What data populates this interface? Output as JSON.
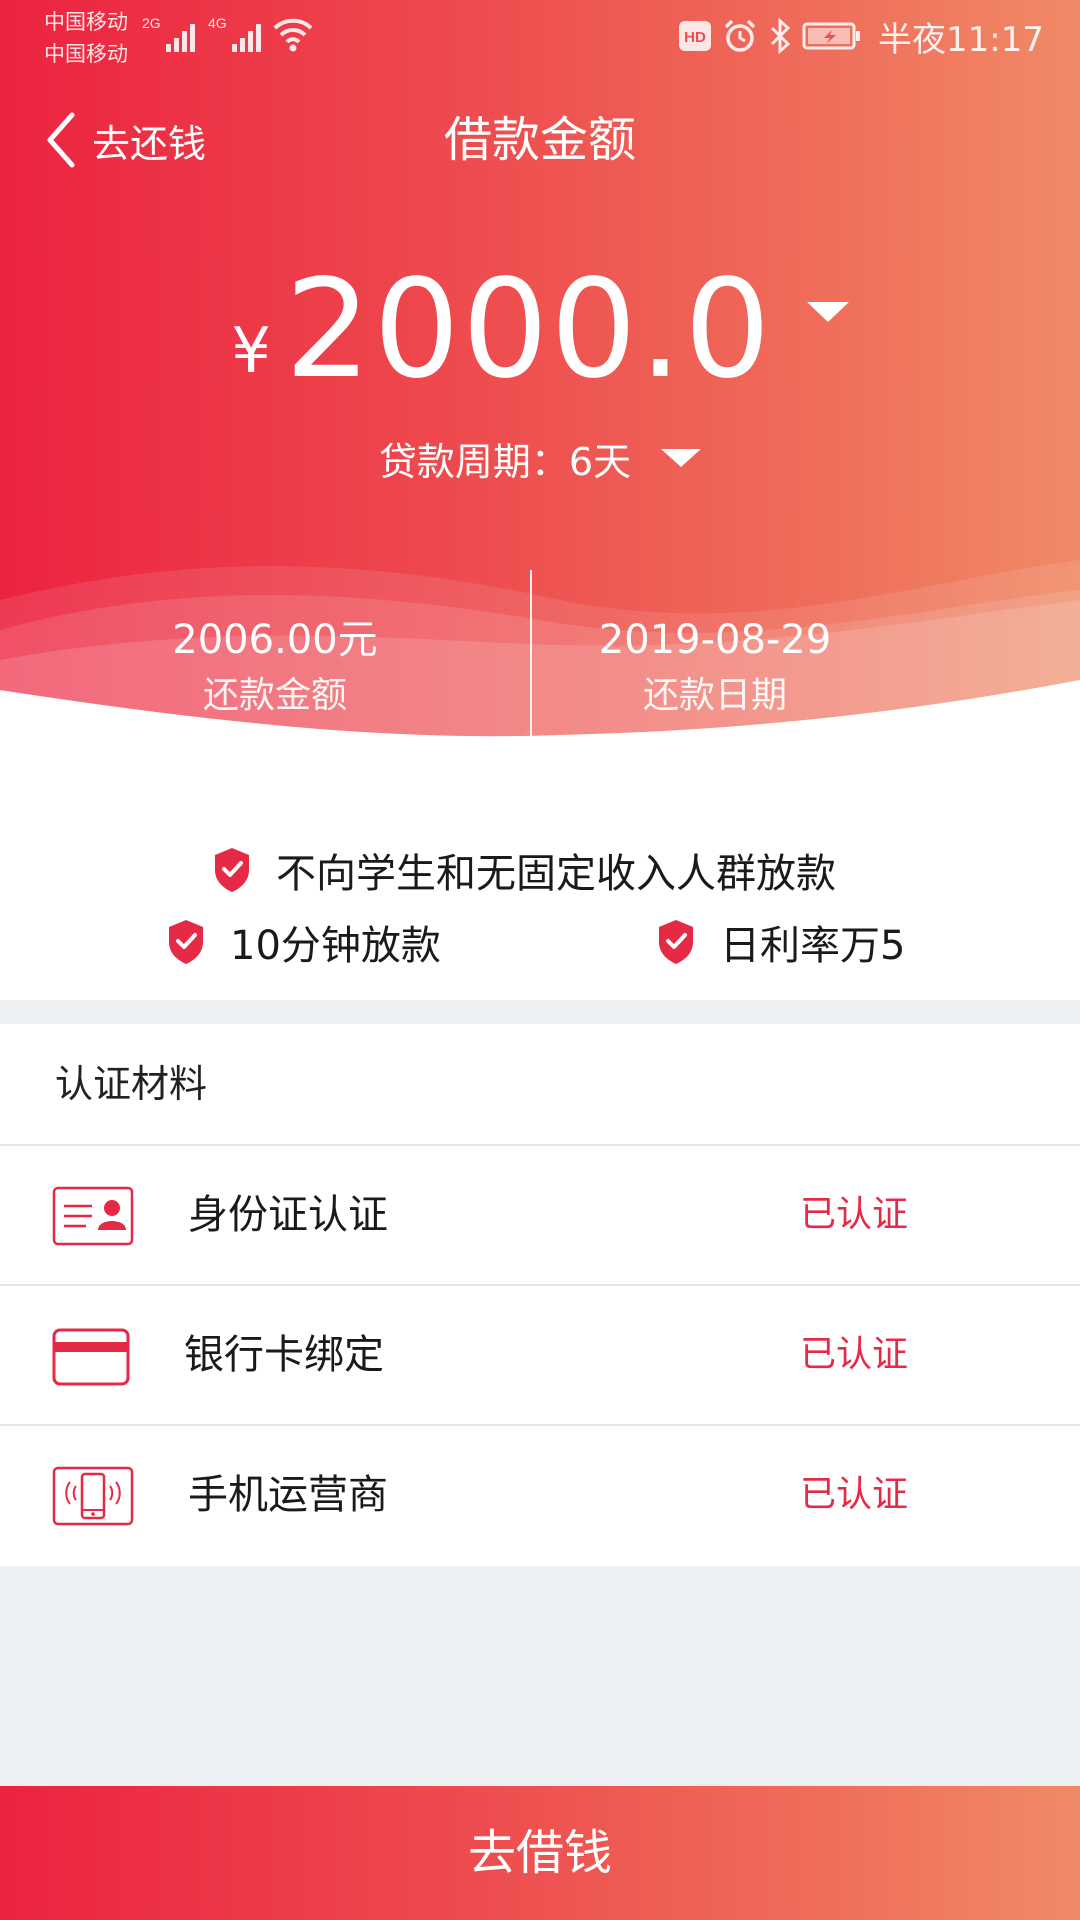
{
  "status_bar": {
    "carrier_1": "中国移动",
    "carrier_2": "中国移动",
    "network_1": "2G",
    "network_2": "4G",
    "hd": "HD",
    "time": "半夜11:17",
    "icons": [
      "signal-icon",
      "wifi-icon",
      "hd-icon",
      "alarm-icon",
      "bluetooth-icon",
      "battery-icon"
    ]
  },
  "nav": {
    "back_label": "去还钱",
    "title": "借款金额"
  },
  "loan": {
    "currency": "¥",
    "amount": "2000.0",
    "period_text": "贷款周期：6天"
  },
  "summary": {
    "repay_amount": "2006.00元",
    "repay_amount_label": "还款金额",
    "repay_date": "2019-08-29",
    "repay_date_label": "还款日期"
  },
  "promises": [
    {
      "text": "不向学生和无固定收入人群放款",
      "icon": "shield-check-icon"
    },
    {
      "text": "10分钟放款",
      "icon": "shield-check-icon"
    },
    {
      "text": "日利率万5",
      "icon": "shield-check-icon"
    }
  ],
  "certification": {
    "header": "认证材料",
    "items": [
      {
        "label": "身份证认证",
        "status": "已认证",
        "icon": "id-card-icon"
      },
      {
        "label": "银行卡绑定",
        "status": "已认证",
        "icon": "bank-card-icon"
      },
      {
        "label": "手机运营商",
        "status": "已认证",
        "icon": "phone-icon"
      }
    ]
  },
  "cta": {
    "label": "去借钱"
  },
  "colors": {
    "accent": "#e52a45",
    "gradient_start": "#ec2340",
    "gradient_end": "#f08a66",
    "background": "#edf0f2"
  }
}
